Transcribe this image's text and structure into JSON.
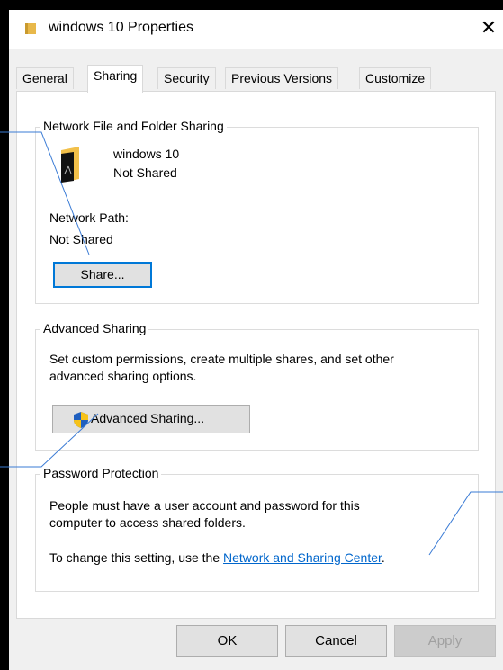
{
  "window": {
    "title": "windows 10 Properties",
    "close_label": "✕"
  },
  "tabs": [
    {
      "label": "General"
    },
    {
      "label": "Sharing"
    },
    {
      "label": "Security"
    },
    {
      "label": "Previous Versions"
    },
    {
      "label": "Customize"
    }
  ],
  "network_sharing": {
    "group_title": "Network File and Folder Sharing",
    "folder_name": "windows 10",
    "folder_status": "Not Shared",
    "path_label": "Network Path:",
    "path_value": "Not Shared",
    "share_button": "Share..."
  },
  "advanced_sharing": {
    "group_title": "Advanced Sharing",
    "description_line1": "Set custom permissions, create multiple shares, and set other",
    "description_line2": "advanced sharing options.",
    "button": "Advanced Sharing..."
  },
  "password_protection": {
    "group_title": "Password Protection",
    "line1": "People must have a user account and password for this",
    "line2": "computer to access shared folders.",
    "change_prefix": "To change this setting, use the ",
    "link": "Network and Sharing Center",
    "change_suffix": "."
  },
  "buttons": {
    "ok": "OK",
    "cancel": "Cancel",
    "apply": "Apply"
  },
  "colors": {
    "accent": "#0078d7",
    "link": "#0066cc",
    "annotation_line": "#3a7bd5"
  }
}
